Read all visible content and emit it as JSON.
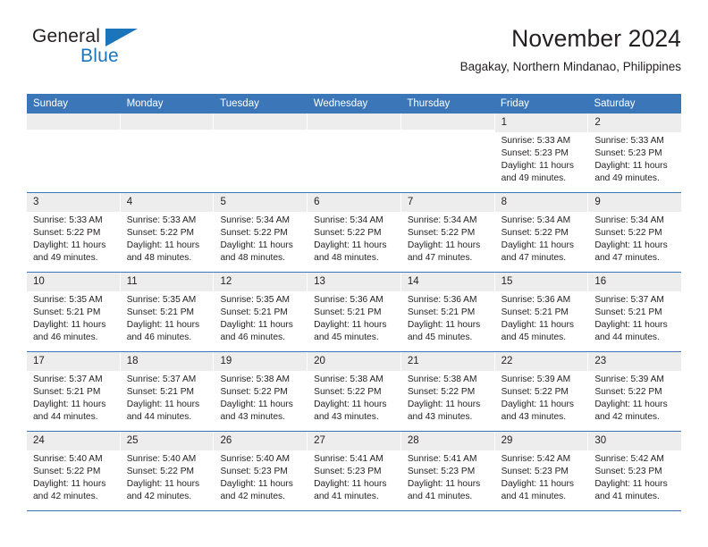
{
  "brand": {
    "word_one": "General",
    "word_two": "Blue",
    "logo_icon": "triangle-icon",
    "accent_color": "#1b75bb"
  },
  "header": {
    "title": "November 2024",
    "subtitle": "Bagakay, Northern Mindanao, Philippines"
  },
  "calendar": {
    "header_color": "#3a76b8",
    "day_number_band_color": "#ededed",
    "weekdays": [
      "Sunday",
      "Monday",
      "Tuesday",
      "Wednesday",
      "Thursday",
      "Friday",
      "Saturday"
    ],
    "weeks": [
      [
        {
          "day": "",
          "empty": true
        },
        {
          "day": "",
          "empty": true
        },
        {
          "day": "",
          "empty": true
        },
        {
          "day": "",
          "empty": true
        },
        {
          "day": "",
          "empty": true
        },
        {
          "day": "1",
          "sunrise": "Sunrise: 5:33 AM",
          "sunset": "Sunset: 5:23 PM",
          "daylight_1": "Daylight: 11 hours",
          "daylight_2": "and 49 minutes."
        },
        {
          "day": "2",
          "sunrise": "Sunrise: 5:33 AM",
          "sunset": "Sunset: 5:23 PM",
          "daylight_1": "Daylight: 11 hours",
          "daylight_2": "and 49 minutes."
        }
      ],
      [
        {
          "day": "3",
          "sunrise": "Sunrise: 5:33 AM",
          "sunset": "Sunset: 5:22 PM",
          "daylight_1": "Daylight: 11 hours",
          "daylight_2": "and 49 minutes."
        },
        {
          "day": "4",
          "sunrise": "Sunrise: 5:33 AM",
          "sunset": "Sunset: 5:22 PM",
          "daylight_1": "Daylight: 11 hours",
          "daylight_2": "and 48 minutes."
        },
        {
          "day": "5",
          "sunrise": "Sunrise: 5:34 AM",
          "sunset": "Sunset: 5:22 PM",
          "daylight_1": "Daylight: 11 hours",
          "daylight_2": "and 48 minutes."
        },
        {
          "day": "6",
          "sunrise": "Sunrise: 5:34 AM",
          "sunset": "Sunset: 5:22 PM",
          "daylight_1": "Daylight: 11 hours",
          "daylight_2": "and 48 minutes."
        },
        {
          "day": "7",
          "sunrise": "Sunrise: 5:34 AM",
          "sunset": "Sunset: 5:22 PM",
          "daylight_1": "Daylight: 11 hours",
          "daylight_2": "and 47 minutes."
        },
        {
          "day": "8",
          "sunrise": "Sunrise: 5:34 AM",
          "sunset": "Sunset: 5:22 PM",
          "daylight_1": "Daylight: 11 hours",
          "daylight_2": "and 47 minutes."
        },
        {
          "day": "9",
          "sunrise": "Sunrise: 5:34 AM",
          "sunset": "Sunset: 5:22 PM",
          "daylight_1": "Daylight: 11 hours",
          "daylight_2": "and 47 minutes."
        }
      ],
      [
        {
          "day": "10",
          "sunrise": "Sunrise: 5:35 AM",
          "sunset": "Sunset: 5:21 PM",
          "daylight_1": "Daylight: 11 hours",
          "daylight_2": "and 46 minutes."
        },
        {
          "day": "11",
          "sunrise": "Sunrise: 5:35 AM",
          "sunset": "Sunset: 5:21 PM",
          "daylight_1": "Daylight: 11 hours",
          "daylight_2": "and 46 minutes."
        },
        {
          "day": "12",
          "sunrise": "Sunrise: 5:35 AM",
          "sunset": "Sunset: 5:21 PM",
          "daylight_1": "Daylight: 11 hours",
          "daylight_2": "and 46 minutes."
        },
        {
          "day": "13",
          "sunrise": "Sunrise: 5:36 AM",
          "sunset": "Sunset: 5:21 PM",
          "daylight_1": "Daylight: 11 hours",
          "daylight_2": "and 45 minutes."
        },
        {
          "day": "14",
          "sunrise": "Sunrise: 5:36 AM",
          "sunset": "Sunset: 5:21 PM",
          "daylight_1": "Daylight: 11 hours",
          "daylight_2": "and 45 minutes."
        },
        {
          "day": "15",
          "sunrise": "Sunrise: 5:36 AM",
          "sunset": "Sunset: 5:21 PM",
          "daylight_1": "Daylight: 11 hours",
          "daylight_2": "and 45 minutes."
        },
        {
          "day": "16",
          "sunrise": "Sunrise: 5:37 AM",
          "sunset": "Sunset: 5:21 PM",
          "daylight_1": "Daylight: 11 hours",
          "daylight_2": "and 44 minutes."
        }
      ],
      [
        {
          "day": "17",
          "sunrise": "Sunrise: 5:37 AM",
          "sunset": "Sunset: 5:21 PM",
          "daylight_1": "Daylight: 11 hours",
          "daylight_2": "and 44 minutes."
        },
        {
          "day": "18",
          "sunrise": "Sunrise: 5:37 AM",
          "sunset": "Sunset: 5:21 PM",
          "daylight_1": "Daylight: 11 hours",
          "daylight_2": "and 44 minutes."
        },
        {
          "day": "19",
          "sunrise": "Sunrise: 5:38 AM",
          "sunset": "Sunset: 5:22 PM",
          "daylight_1": "Daylight: 11 hours",
          "daylight_2": "and 43 minutes."
        },
        {
          "day": "20",
          "sunrise": "Sunrise: 5:38 AM",
          "sunset": "Sunset: 5:22 PM",
          "daylight_1": "Daylight: 11 hours",
          "daylight_2": "and 43 minutes."
        },
        {
          "day": "21",
          "sunrise": "Sunrise: 5:38 AM",
          "sunset": "Sunset: 5:22 PM",
          "daylight_1": "Daylight: 11 hours",
          "daylight_2": "and 43 minutes."
        },
        {
          "day": "22",
          "sunrise": "Sunrise: 5:39 AM",
          "sunset": "Sunset: 5:22 PM",
          "daylight_1": "Daylight: 11 hours",
          "daylight_2": "and 43 minutes."
        },
        {
          "day": "23",
          "sunrise": "Sunrise: 5:39 AM",
          "sunset": "Sunset: 5:22 PM",
          "daylight_1": "Daylight: 11 hours",
          "daylight_2": "and 42 minutes."
        }
      ],
      [
        {
          "day": "24",
          "sunrise": "Sunrise: 5:40 AM",
          "sunset": "Sunset: 5:22 PM",
          "daylight_1": "Daylight: 11 hours",
          "daylight_2": "and 42 minutes."
        },
        {
          "day": "25",
          "sunrise": "Sunrise: 5:40 AM",
          "sunset": "Sunset: 5:22 PM",
          "daylight_1": "Daylight: 11 hours",
          "daylight_2": "and 42 minutes."
        },
        {
          "day": "26",
          "sunrise": "Sunrise: 5:40 AM",
          "sunset": "Sunset: 5:23 PM",
          "daylight_1": "Daylight: 11 hours",
          "daylight_2": "and 42 minutes."
        },
        {
          "day": "27",
          "sunrise": "Sunrise: 5:41 AM",
          "sunset": "Sunset: 5:23 PM",
          "daylight_1": "Daylight: 11 hours",
          "daylight_2": "and 41 minutes."
        },
        {
          "day": "28",
          "sunrise": "Sunrise: 5:41 AM",
          "sunset": "Sunset: 5:23 PM",
          "daylight_1": "Daylight: 11 hours",
          "daylight_2": "and 41 minutes."
        },
        {
          "day": "29",
          "sunrise": "Sunrise: 5:42 AM",
          "sunset": "Sunset: 5:23 PM",
          "daylight_1": "Daylight: 11 hours",
          "daylight_2": "and 41 minutes."
        },
        {
          "day": "30",
          "sunrise": "Sunrise: 5:42 AM",
          "sunset": "Sunset: 5:23 PM",
          "daylight_1": "Daylight: 11 hours",
          "daylight_2": "and 41 minutes."
        }
      ]
    ]
  }
}
